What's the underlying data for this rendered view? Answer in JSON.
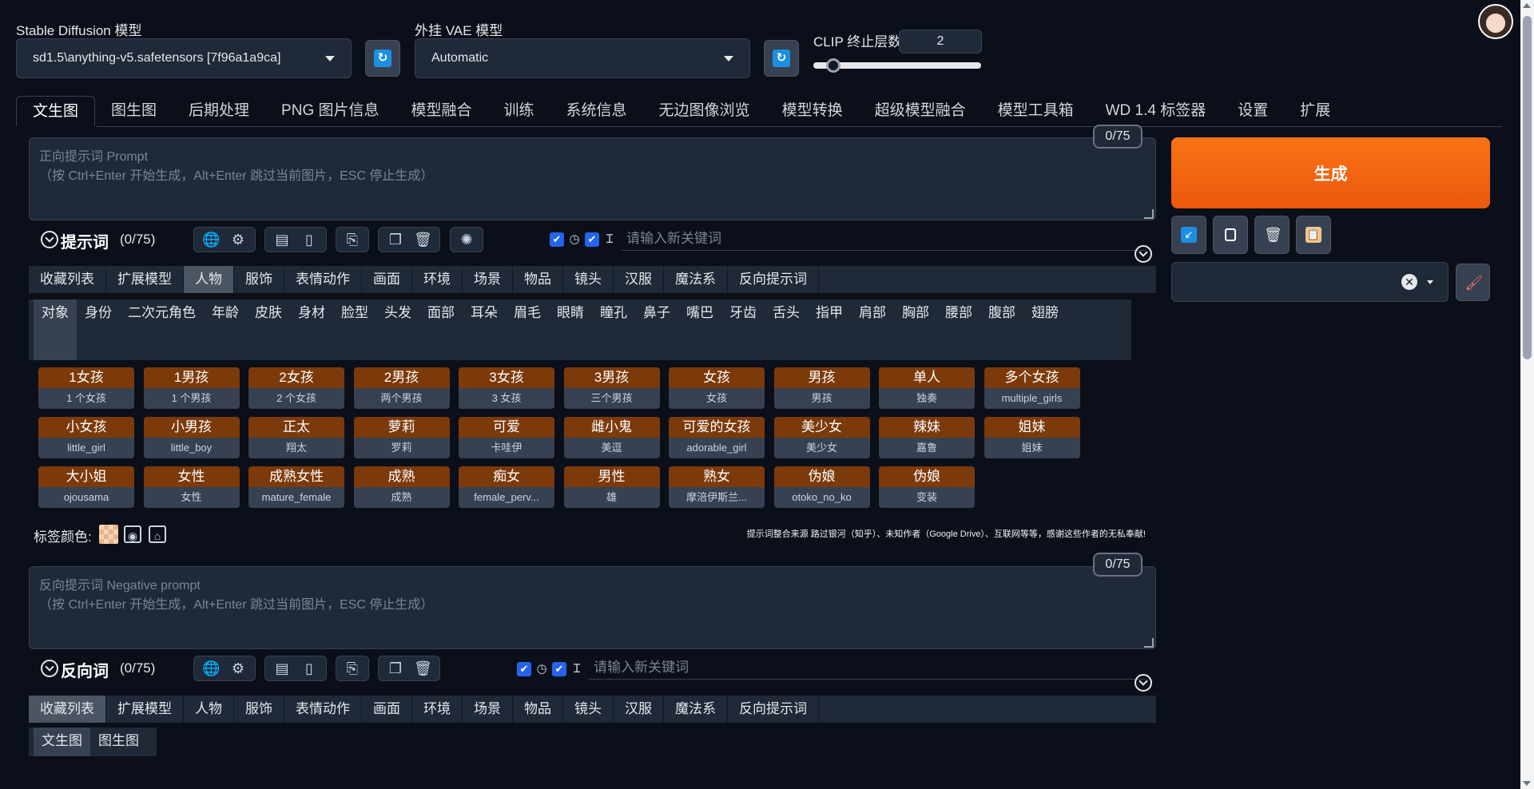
{
  "models": {
    "sd_label": "Stable Diffusion 模型",
    "sd_value": "sd1.5\\anything-v5.safetensors [7f96a1a9ca]",
    "vae_label": "外挂 VAE 模型",
    "vae_value": "Automatic",
    "clip_label": "CLIP 终止层数",
    "clip_value": "2"
  },
  "tabs": [
    "文生图",
    "图生图",
    "后期处理",
    "PNG 图片信息",
    "模型融合",
    "训练",
    "系统信息",
    "无边图像浏览",
    "模型转换",
    "超级模型融合",
    "模型工具箱",
    "WD 1.4 标签器",
    "设置",
    "扩展"
  ],
  "prompt": {
    "counter": "0/75",
    "placeholder_line1": "正向提示词 Prompt",
    "placeholder_line2": "（按 Ctrl+Enter 开始生成，Alt+Enter 跳过当前图片，ESC 停止生成）",
    "section_title": "提示词",
    "section_count": "(0/75)",
    "kw_placeholder": "请输入新关键词"
  },
  "categories": [
    "收藏列表",
    "扩展模型",
    "人物",
    "服饰",
    "表情动作",
    "画面",
    "环境",
    "场景",
    "物品",
    "镜头",
    "汉服",
    "魔法系",
    "反向提示词"
  ],
  "subcategories": [
    "对象",
    "身份",
    "二次元角色",
    "年龄",
    "皮肤",
    "身材",
    "脸型",
    "头发",
    "面部",
    "耳朵",
    "眉毛",
    "眼睛",
    "瞳孔",
    "鼻子",
    "嘴巴",
    "牙齿",
    "舌头",
    "指甲",
    "肩部",
    "胸部",
    "腰部",
    "腹部",
    "翅膀"
  ],
  "tags": [
    {
      "t": "1女孩",
      "s": "1 个女孩"
    },
    {
      "t": "1男孩",
      "s": "1 个男孩"
    },
    {
      "t": "2女孩",
      "s": "2 个女孩"
    },
    {
      "t": "2男孩",
      "s": "两个男孩"
    },
    {
      "t": "3女孩",
      "s": "3 女孩"
    },
    {
      "t": "3男孩",
      "s": "三个男孩"
    },
    {
      "t": "女孩",
      "s": "女孩"
    },
    {
      "t": "男孩",
      "s": "男孩"
    },
    {
      "t": "单人",
      "s": "独奏"
    },
    {
      "t": "多个女孩",
      "s": "multiple_girls"
    },
    {
      "t": "小女孩",
      "s": "little_girl"
    },
    {
      "t": "小男孩",
      "s": "little_boy"
    },
    {
      "t": "正太",
      "s": "翔太"
    },
    {
      "t": "萝莉",
      "s": "罗莉"
    },
    {
      "t": "可爱",
      "s": "卡哇伊"
    },
    {
      "t": "雌小鬼",
      "s": "美逗"
    },
    {
      "t": "可爱的女孩",
      "s": "adorable_girl"
    },
    {
      "t": "美少女",
      "s": "美少女"
    },
    {
      "t": "辣妹",
      "s": "嘉鲁"
    },
    {
      "t": "姐妹",
      "s": "姐妹"
    },
    {
      "t": "大小姐",
      "s": "ojousama"
    },
    {
      "t": "女性",
      "s": "女性"
    },
    {
      "t": "成熟女性",
      "s": "mature_female"
    },
    {
      "t": "成熟",
      "s": "成熟"
    },
    {
      "t": "痴女",
      "s": "female_perv..."
    },
    {
      "t": "男性",
      "s": "雄"
    },
    {
      "t": "熟女",
      "s": "摩涪伊斯兰..."
    },
    {
      "t": "伪娘",
      "s": "otoko_no_ko"
    },
    {
      "t": "伪娘",
      "s": "变装"
    }
  ],
  "tag_color_label": "标签颜色:",
  "credits": "提示词整合来源 路过银河（知乎）、未知作者（Google Drive）、互联网等等，感谢这些作者的无私奉献!",
  "negative": {
    "counter": "0/75",
    "placeholder_line1": "反向提示词 Negative prompt",
    "placeholder_line2": "（按 Ctrl+Enter 开始生成，Alt+Enter 跳过当前图片，ESC 停止生成）",
    "section_title": "反向词",
    "section_count": "(0/75)",
    "kw_placeholder": "请输入新关键词",
    "sub_tabs": [
      "文生图",
      "图生图"
    ]
  },
  "generate_label": "生成"
}
